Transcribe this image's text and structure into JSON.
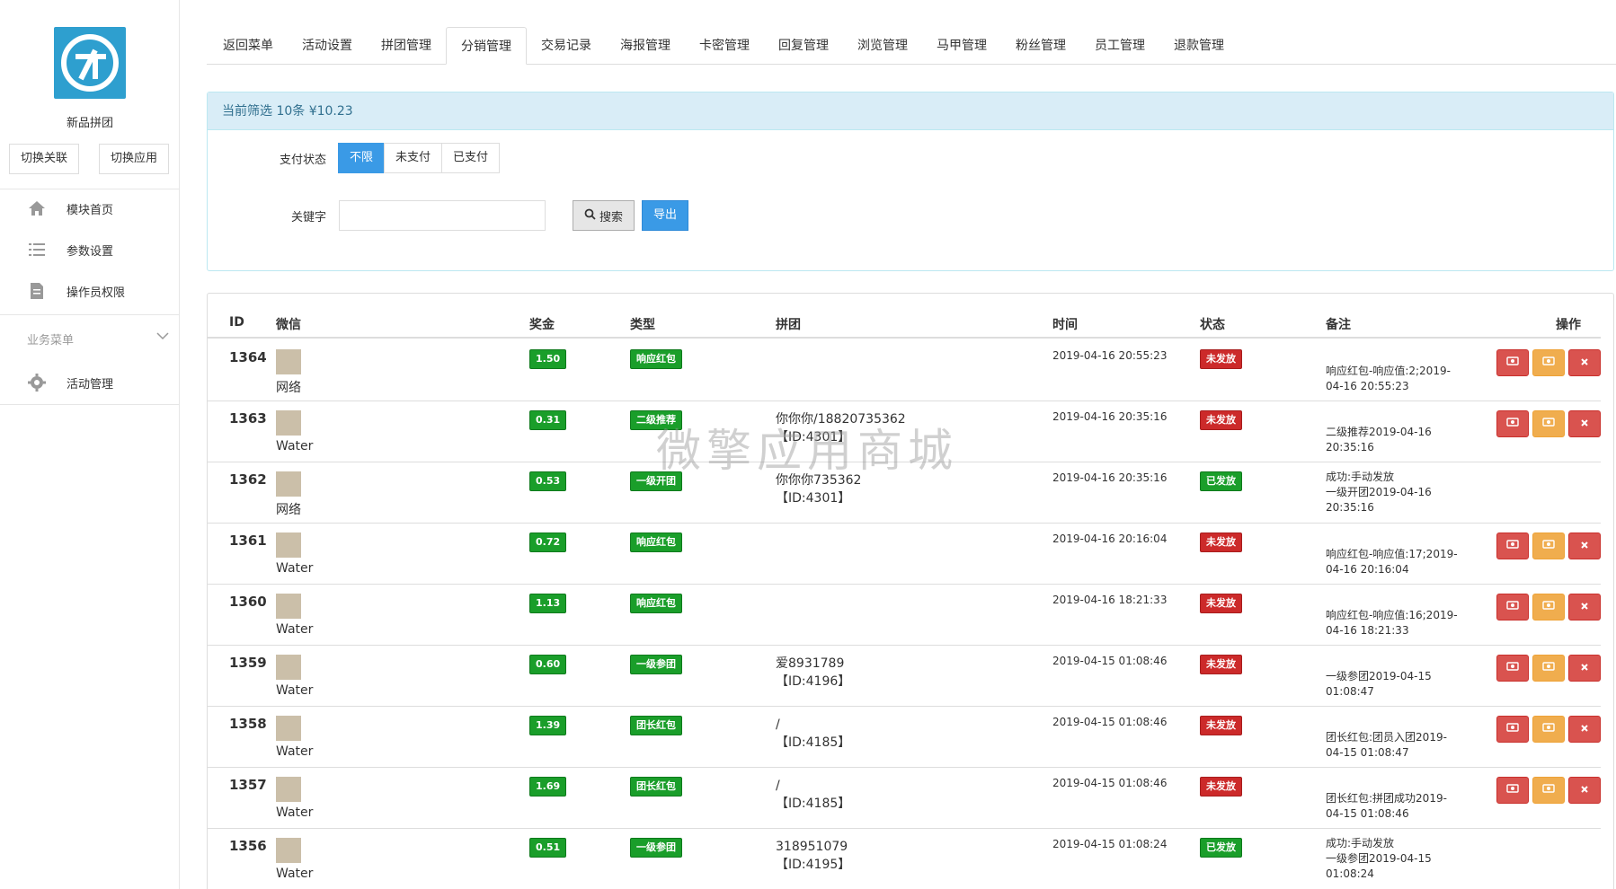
{
  "sidebar": {
    "app_name": "新品拼团",
    "switch_link_label": "切换关联",
    "switch_app_label": "切换应用",
    "items": [
      {
        "label": "模块首页",
        "icon": "home-icon"
      },
      {
        "label": "参数设置",
        "icon": "list-icon"
      },
      {
        "label": "操作员权限",
        "icon": "document-icon"
      }
    ],
    "section_label": "业务菜单",
    "activity_label": "活动管理"
  },
  "tabs": [
    "返回菜单",
    "活动设置",
    "拼团管理",
    "分销管理",
    "交易记录",
    "海报管理",
    "卡密管理",
    "回复管理",
    "浏览管理",
    "马甲管理",
    "粉丝管理",
    "员工管理",
    "退款管理"
  ],
  "active_tab": "分销管理",
  "filter": {
    "summary": "当前筛选 10条 ¥10.23",
    "pay_status_label": "支付状态",
    "pay_options": [
      "不限",
      "未支付",
      "已支付"
    ],
    "pay_selected": "不限",
    "keyword_label": "关键字",
    "keyword_value": "",
    "search_label": "搜索",
    "export_label": "导出"
  },
  "table": {
    "headers": {
      "id": "ID",
      "wechat": "微信",
      "bonus": "奖金",
      "type": "类型",
      "group": "拼团",
      "time": "时间",
      "status": "状态",
      "note": "备注",
      "ops": "操作"
    },
    "rows": [
      {
        "id": "1364",
        "wechat": "网络",
        "bonus": "1.50",
        "type": "响应红包",
        "group": "",
        "time": "2019-04-16 20:55:23",
        "status": "未发放",
        "note": "响应红包-响应值:2;2019-04-16 20:55:23"
      },
      {
        "id": "1363",
        "wechat": "Water",
        "bonus": "0.31",
        "type": "二级推荐",
        "group": "你你你/18820735362\n【ID:4301】",
        "time": "2019-04-16 20:35:16",
        "status": "未发放",
        "note": "二级推荐2019-04-16 20:35:16"
      },
      {
        "id": "1362",
        "wechat": "网络",
        "bonus": "0.53",
        "type": "一级开团",
        "group": "你你你735362\n【ID:4301】",
        "time": "2019-04-16 20:35:16",
        "status": "已发放",
        "note": "成功:手动发放\n一级开团2019-04-16 20:35:16"
      },
      {
        "id": "1361",
        "wechat": "Water",
        "bonus": "0.72",
        "type": "响应红包",
        "group": "",
        "time": "2019-04-16 20:16:04",
        "status": "未发放",
        "note": "响应红包-响应值:17;2019-04-16 20:16:04"
      },
      {
        "id": "1360",
        "wechat": "Water",
        "bonus": "1.13",
        "type": "响应红包",
        "group": "",
        "time": "2019-04-16 18:21:33",
        "status": "未发放",
        "note": "响应红包-响应值:16;2019-04-16 18:21:33"
      },
      {
        "id": "1359",
        "wechat": "Water",
        "bonus": "0.60",
        "type": "一级参团",
        "group": "爱8931789\n【ID:4196】",
        "time": "2019-04-15 01:08:46",
        "status": "未发放",
        "note": "一级参团2019-04-15 01:08:47"
      },
      {
        "id": "1358",
        "wechat": "Water",
        "bonus": "1.39",
        "type": "团长红包",
        "group": "/\n【ID:4185】",
        "time": "2019-04-15 01:08:46",
        "status": "未发放",
        "note": "团长红包:团员入团2019-04-15 01:08:47"
      },
      {
        "id": "1357",
        "wechat": "Water",
        "bonus": "1.69",
        "type": "团长红包",
        "group": "/\n【ID:4185】",
        "time": "2019-04-15 01:08:46",
        "status": "未发放",
        "note": "团长红包:拼团成功2019-04-15 01:08:46"
      },
      {
        "id": "1356",
        "wechat": "Water",
        "bonus": "0.51",
        "type": "一级参团",
        "group": "318951079\n【ID:4195】",
        "time": "2019-04-15 01:08:24",
        "status": "已发放",
        "note": "成功:手动发放\n一级参团2019-04-15 01:08:24"
      }
    ]
  },
  "watermark": "微擎应用商城"
}
